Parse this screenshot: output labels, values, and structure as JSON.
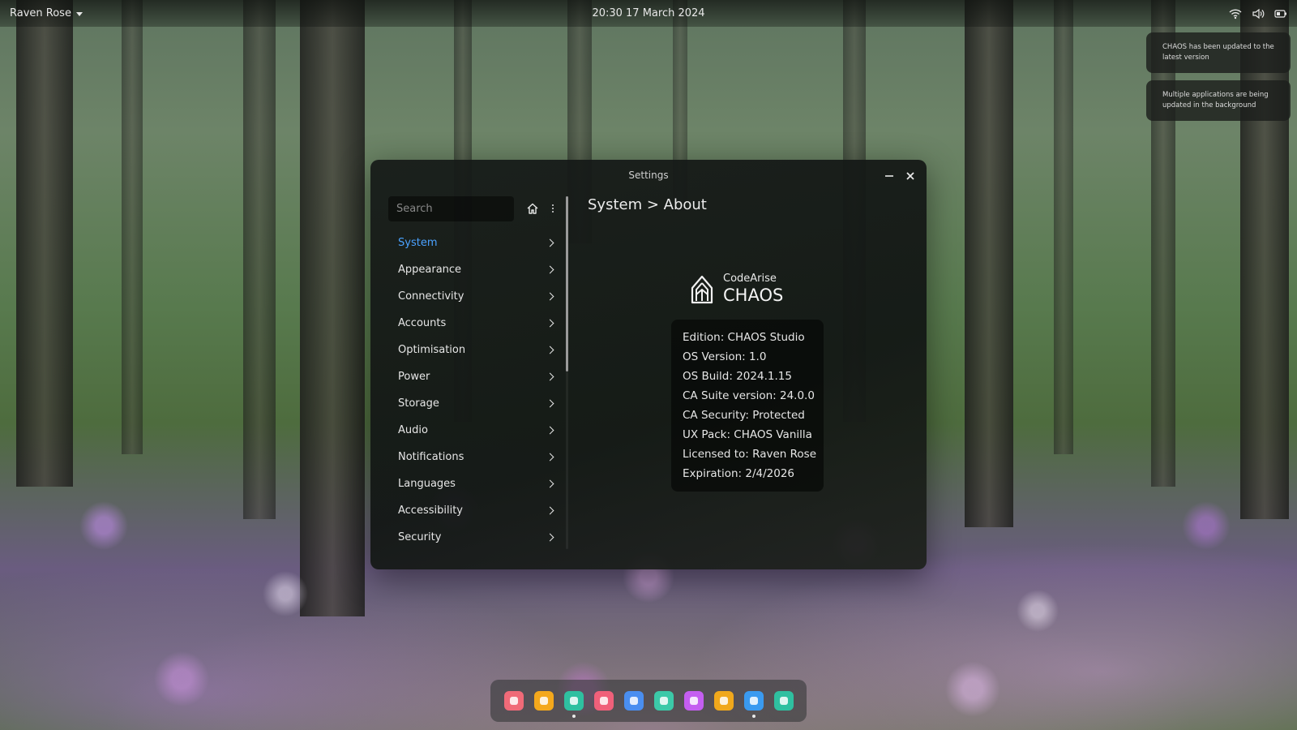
{
  "topbar": {
    "user_name": "Raven Rose",
    "clock": "20:30 17 March 2024",
    "tray_icons": [
      "wifi-icon",
      "volume-icon",
      "battery-icon"
    ]
  },
  "notifications": [
    {
      "text": "CHAOS has been updated to the latest version"
    },
    {
      "text": "Multiple applications are being updated in the background"
    }
  ],
  "settings": {
    "title": "Settings",
    "search_placeholder": "Search",
    "breadcrumb": "System > About",
    "nav_items": [
      {
        "label": "System",
        "active": true
      },
      {
        "label": "Appearance"
      },
      {
        "label": "Connectivity"
      },
      {
        "label": "Accounts"
      },
      {
        "label": "Optimisation"
      },
      {
        "label": "Power"
      },
      {
        "label": "Storage"
      },
      {
        "label": "Audio"
      },
      {
        "label": "Notifications"
      },
      {
        "label": "Languages"
      },
      {
        "label": "Accessibility"
      },
      {
        "label": "Security"
      }
    ],
    "about": {
      "company": "CodeArise",
      "product": "CHAOS",
      "details": [
        "Edition: CHAOS Studio",
        "OS Version: 1.0",
        "OS Build: 2024.1.15",
        "CA Suite version: 24.0.0",
        "CA Security: Protected",
        "UX Pack: CHAOS Vanilla",
        "Licensed to: Raven Rose",
        "Expiration: 2/4/2026"
      ]
    },
    "accent_color": "#4aa2ff"
  },
  "dock": {
    "apps": [
      {
        "icon": "calendar-app-icon",
        "color": "#f06a78",
        "running": false
      },
      {
        "icon": "files-app-icon",
        "color": "#f4a81c",
        "running": false
      },
      {
        "icon": "settings-app-icon",
        "color": "#2fc0a0",
        "running": true
      },
      {
        "icon": "mail-app-icon",
        "color": "#f0607a",
        "running": false
      },
      {
        "icon": "messages-app-icon",
        "color": "#4a8ef0",
        "running": false
      },
      {
        "icon": "planner-app-icon",
        "color": "#3cc9a8",
        "running": false
      },
      {
        "icon": "store-app-icon",
        "color": "#c45ef0",
        "running": false
      },
      {
        "icon": "analytics-app-icon",
        "color": "#f0a81c",
        "running": false
      },
      {
        "icon": "cloud-app-icon",
        "color": "#3a9af0",
        "running": true
      },
      {
        "icon": "ideas-app-icon",
        "color": "#2fc0a0",
        "running": false
      }
    ]
  }
}
